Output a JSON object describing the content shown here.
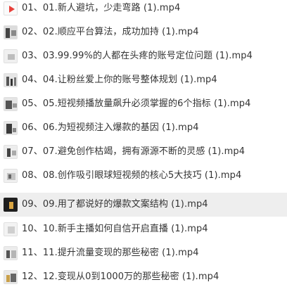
{
  "files": [
    {
      "name": "01、01.新人避坑，少走弯路 (1).mp4",
      "icon": "video-play-icon",
      "selected": false
    },
    {
      "name": "02、02.顺应平台算法，成功加持 (1).mp4",
      "icon": "video-thumbnail-icon",
      "selected": false
    },
    {
      "name": "03、03.99.99%的人都在头疼的账号定位问题 (1).mp4",
      "icon": "video-thumbnail-icon",
      "selected": false
    },
    {
      "name": "04、04.让粉丝爱上你的账号整体规划 (1).mp4",
      "icon": "video-thumbnail-icon",
      "selected": false
    },
    {
      "name": "05、05.短视频播放量飙升必须掌握的6个指标 (1).mp4",
      "icon": "video-thumbnail-icon",
      "selected": false
    },
    {
      "name": "06、06.为短视频注入爆款的基因 (1).mp4",
      "icon": "video-thumbnail-icon",
      "selected": false
    },
    {
      "name": "07、07.避免创作枯竭，拥有源源不断的灵感 (1).mp4",
      "icon": "video-thumbnail-icon",
      "selected": false
    },
    {
      "name": "08、08.创作吸引眼球短视频的核心5大技巧 (1).mp4",
      "icon": "video-thumbnail-icon",
      "selected": false
    },
    {
      "name": "09、09.用了都说好的爆款文案结构 (1).mp4",
      "icon": "video-thumbnail-icon",
      "selected": true
    },
    {
      "name": "10、10.新手主播如何自信开启直播 (1).mp4",
      "icon": "video-thumbnail-icon",
      "selected": false
    },
    {
      "name": "11、11.提升流量变现的那些秘密 (1).mp4",
      "icon": "video-thumbnail-icon",
      "selected": false
    },
    {
      "name": "12、12.变现从0到1000万的那些秘密 (1).mp4",
      "icon": "video-thumbnail-icon",
      "selected": false
    }
  ],
  "colors": {
    "text": "#333333",
    "selected_background": "#eeeeee",
    "play_icon_red": "#e8403a"
  }
}
